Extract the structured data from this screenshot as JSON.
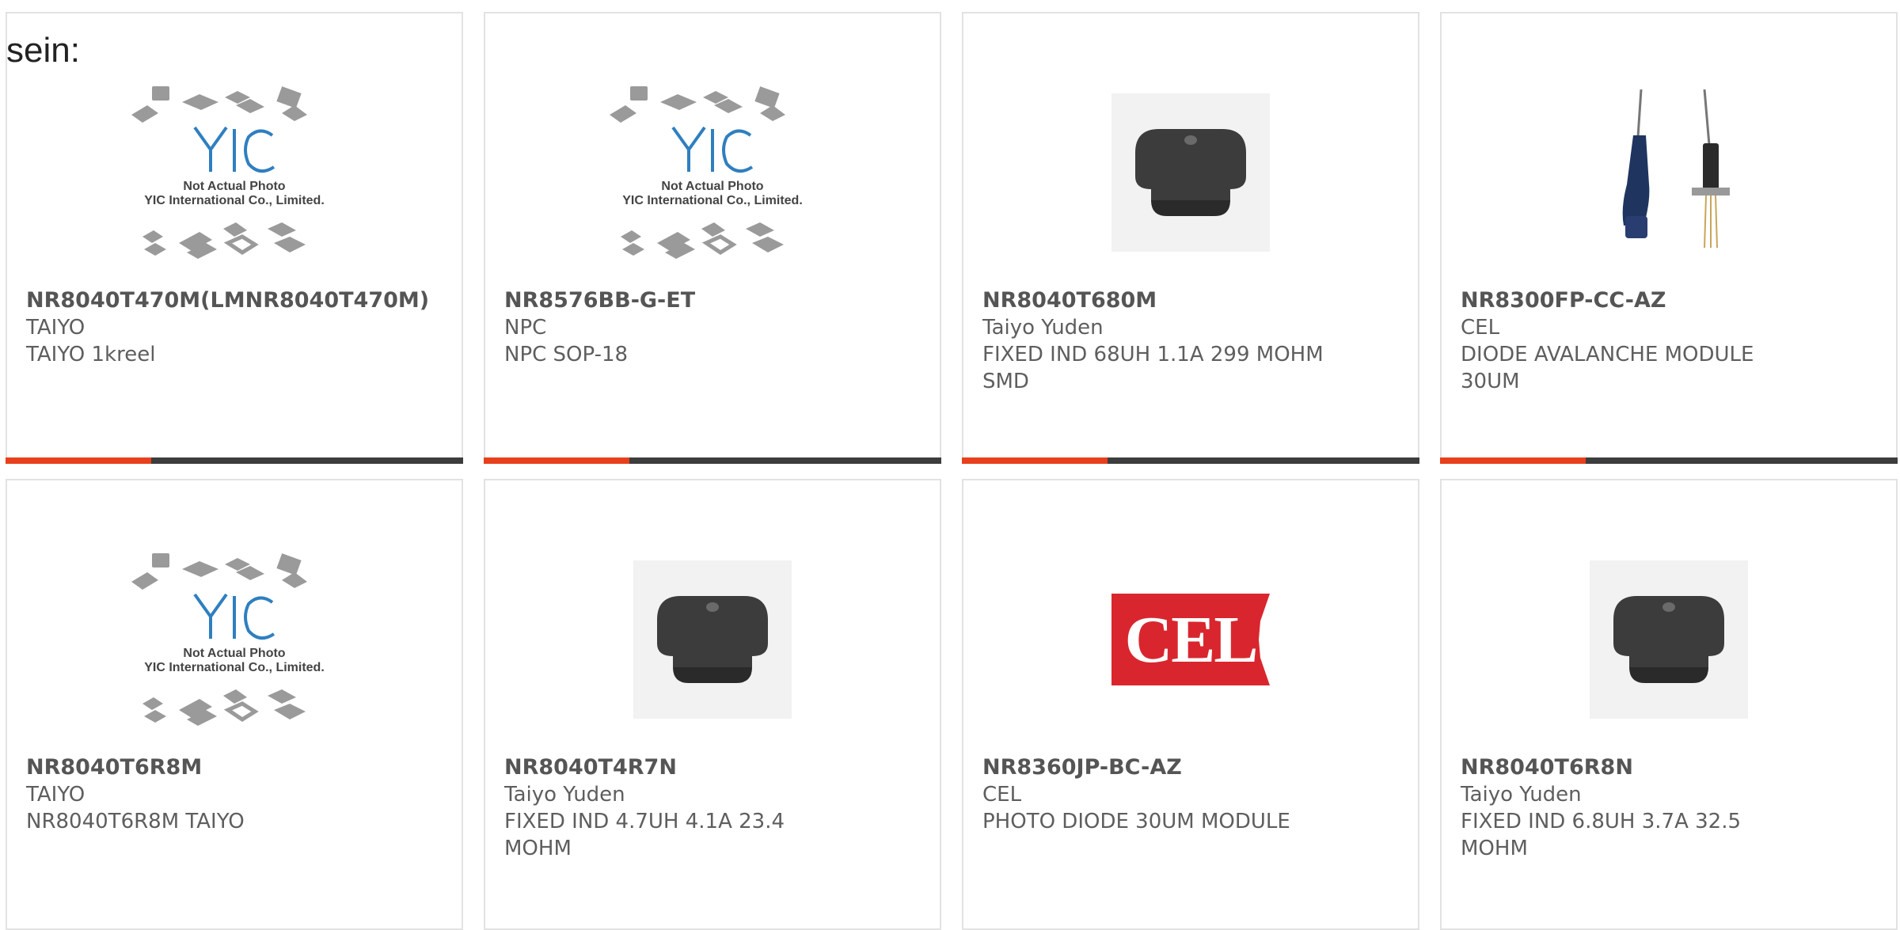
{
  "stray_text": "sein:",
  "placeholder": {
    "line1": "Not Actual Photo",
    "line2": "YIC International Co., Limited."
  },
  "cel_logo_text": "CEL",
  "colors": {
    "accent": "#e8401c",
    "bar": "#3d3d3d",
    "border": "#e2e2e2",
    "text": "#5e5e5e"
  },
  "products": [
    {
      "part": "NR8040T470M(LMNR8040T470M)",
      "manufacturer": "TAIYO",
      "description": "TAIYO 1kreel",
      "image": "yic-placeholder"
    },
    {
      "part": "NR8576BB-G-ET",
      "manufacturer": "NPC",
      "description": "NPC SOP-18",
      "image": "yic-placeholder"
    },
    {
      "part": "NR8040T680M",
      "manufacturer": "Taiyo Yuden",
      "description": "FIXED IND 68UH 1.1A 299 MOHM SMD",
      "image": "smd-inductor"
    },
    {
      "part": "NR8300FP-CC-AZ",
      "manufacturer": "CEL",
      "description": "DIODE AVALANCHE MODULE 30UM",
      "image": "fiber-diode-module"
    },
    {
      "part": "NR8040T6R8M",
      "manufacturer": "TAIYO",
      "description": "NR8040T6R8M TAIYO",
      "image": "yic-placeholder"
    },
    {
      "part": "NR8040T4R7N",
      "manufacturer": "Taiyo Yuden",
      "description": "FIXED IND 4.7UH 4.1A 23.4 MOHM",
      "image": "smd-inductor"
    },
    {
      "part": "NR8360JP-BC-AZ",
      "manufacturer": "CEL",
      "description": "PHOTO DIODE 30UM MODULE",
      "image": "cel-logo"
    },
    {
      "part": "NR8040T6R8N",
      "manufacturer": "Taiyo Yuden",
      "description": "FIXED IND 6.8UH 3.7A 32.5 MOHM",
      "image": "smd-inductor"
    }
  ]
}
